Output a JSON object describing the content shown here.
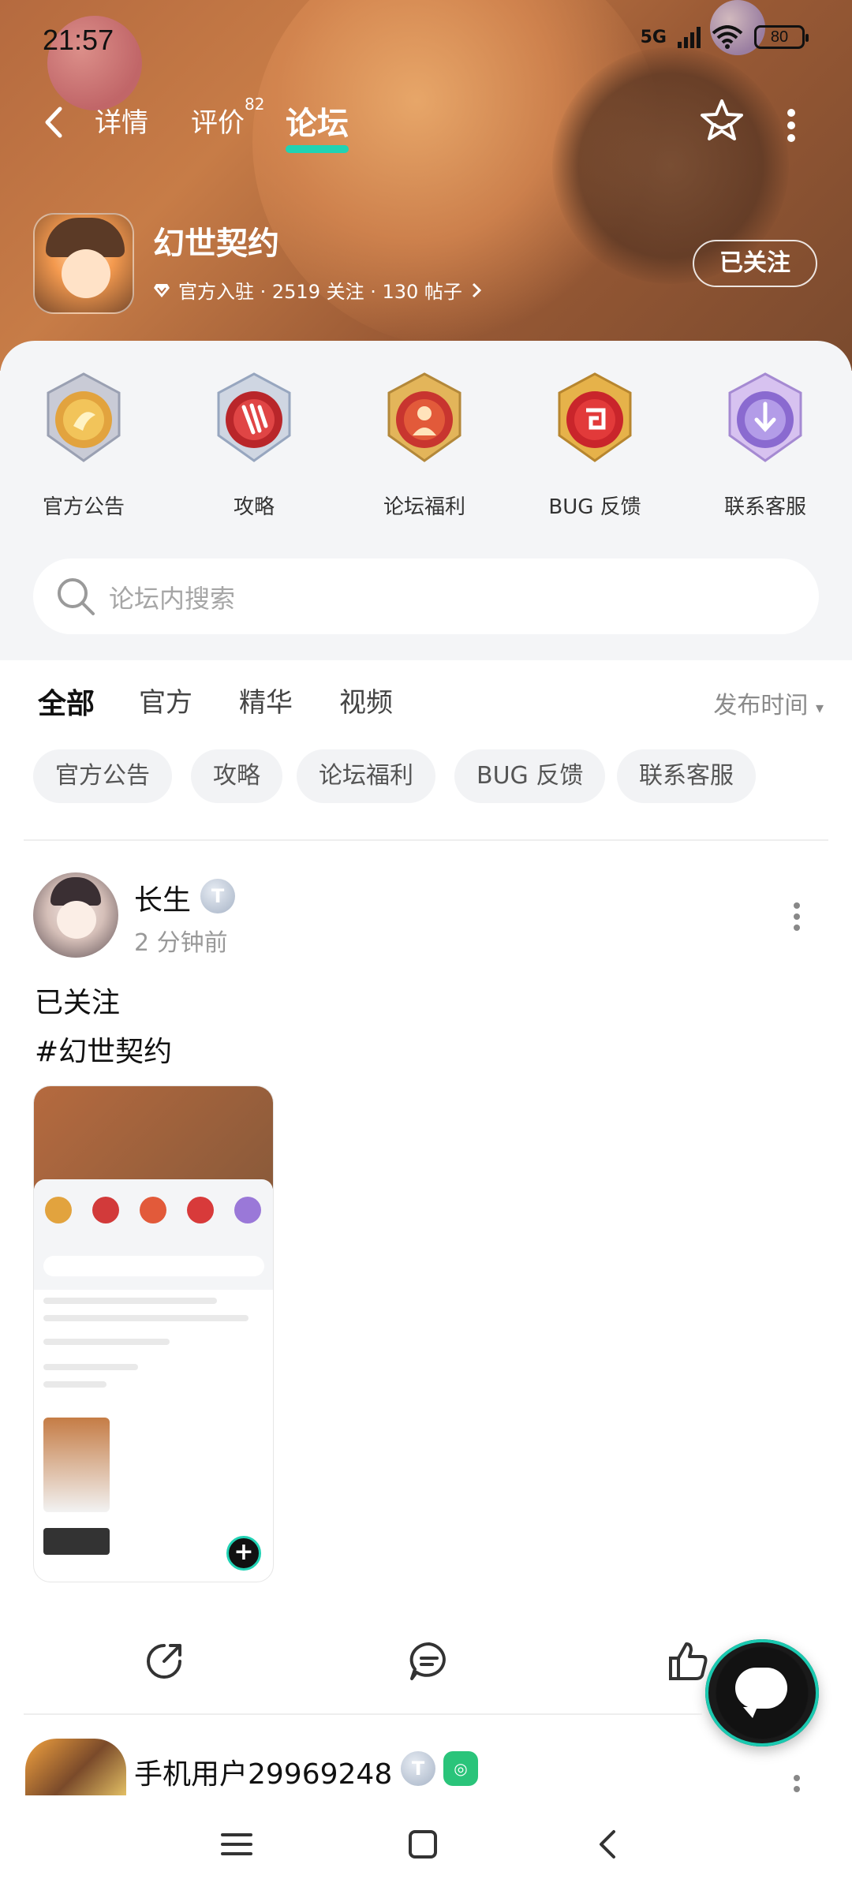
{
  "status_bar": {
    "time": "21:57",
    "network": "5G",
    "battery": "80"
  },
  "nav": {
    "tabs": [
      {
        "label": "详情"
      },
      {
        "label": "评价"
      },
      {
        "label": "论坛"
      }
    ],
    "review_count": "82"
  },
  "game": {
    "name": "幻世契约",
    "meta": "官方入驻 · 2519 关注 · 130 帖子",
    "follow_label": "已关注"
  },
  "categories": [
    {
      "label": "官方公告",
      "color": "#e8b34a"
    },
    {
      "label": "攻略",
      "color": "#d23a3a"
    },
    {
      "label": "论坛福利",
      "color": "#e25a3a"
    },
    {
      "label": "BUG 反馈",
      "color": "#d83a3a"
    },
    {
      "label": "联系客服",
      "color": "#9a78d8"
    }
  ],
  "search": {
    "placeholder": "论坛内搜索"
  },
  "feed_tabs": [
    {
      "label": "全部"
    },
    {
      "label": "官方"
    },
    {
      "label": "精华"
    },
    {
      "label": "视频"
    }
  ],
  "sort_label": "发布时间",
  "chips": [
    {
      "label": "官方公告"
    },
    {
      "label": "攻略"
    },
    {
      "label": "论坛福利"
    },
    {
      "label": "BUG 反馈"
    },
    {
      "label": "联系客服"
    }
  ],
  "post": {
    "author": "长生",
    "level": "T",
    "time": "2 分钟前",
    "text1": "已关注",
    "text2": "#幻世契约"
  },
  "post2": {
    "author": "手机用户29969248",
    "level": "T"
  },
  "colors": {
    "accent": "#20d3b3",
    "header": "#b56a3f"
  }
}
